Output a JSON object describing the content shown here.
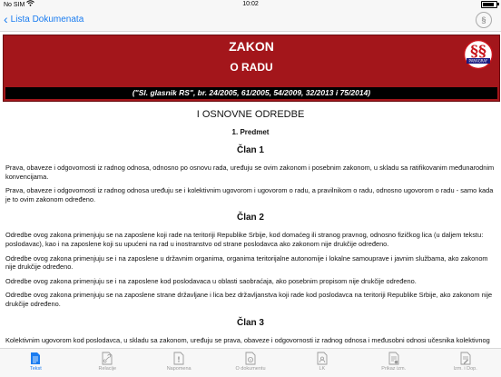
{
  "status": {
    "carrier": "No SIM",
    "time": "10:02",
    "battery_level": 0.85
  },
  "nav": {
    "back_label": "Lista Dokumenata"
  },
  "banner": {
    "title": "ZAKON",
    "subtitle": "O RADU",
    "gazette": "(\"Sl. glasnik RS\", br. 24/2005, 61/2005, 54/2009, 32/2013 i 75/2014)",
    "seal_text": "PARAGRAF"
  },
  "document": {
    "section_title": "I OSNOVNE ODREDBE",
    "subsection_title": "1. Predmet",
    "articles": [
      {
        "heading": "Član 1",
        "paragraphs": [
          "Prava, obaveze i odgovornosti iz radnog odnosa, odnosno po osnovu rada, uređuju se ovim zakonom i posebnim zakonom, u skladu sa ratifikovanim međunarodnim konvencijama.",
          "Prava, obaveze i odgovornosti iz radnog odnosa uređuju se i kolektivnim ugovorom i ugovorom o radu, a pravilnikom o radu, odnosno ugovorom o radu - samo kada je to ovim zakonom određeno."
        ]
      },
      {
        "heading": "Član 2",
        "paragraphs": [
          "Odredbe ovog zakona primenjuju se na zaposlene koji rade na teritoriji Republike Srbije, kod domaćeg ili stranog pravnog, odnosno fizičkog lica (u daljem tekstu: poslodavac), kao i na zaposlene koji su upućeni na rad u inostranstvo od strane poslodavca ako zakonom nije drukčije određeno.",
          "Odredbe ovog zakona primenjuju se i na zaposlene u državnim organima, organima teritorijalne autonomije i lokalne samouprave i javnim službama, ako zakonom nije drukčije određeno.",
          "Odredbe ovog zakona primenjuju se i na zaposlene kod poslodavaca u oblasti saobraćaja, ako posebnim propisom nije drukčije određeno.",
          "Odredbe ovog zakona primenjuju se na zaposlene strane državljane i lica bez državljanstva koji rade kod poslodavca na teritoriji Republike Srbije, ako zakonom nije drukčije određeno."
        ]
      },
      {
        "heading": "Član 3",
        "paragraphs": [
          "Kolektivnim ugovorom kod poslodavca, u skladu sa zakonom, uređuju se prava, obaveze i odgovornosti iz radnog odnosa i međusobni odnosi učesnika kolektivnog ugovora."
        ]
      }
    ]
  },
  "tabs": [
    {
      "label": "Tekst",
      "icon": "document-text-icon",
      "active": true
    },
    {
      "label": "Relacije",
      "icon": "link-icon",
      "active": false
    },
    {
      "label": "Napomena",
      "icon": "note-icon",
      "active": false
    },
    {
      "label": "O dokumentu",
      "icon": "document-info-icon",
      "active": false
    },
    {
      "label": "LK",
      "icon": "id-card-icon",
      "active": false
    },
    {
      "label": "Prikaz izm.",
      "icon": "document-changes-icon",
      "active": false
    },
    {
      "label": "Izm. i Dop.",
      "icon": "document-edit-icon",
      "active": false
    }
  ],
  "colors": {
    "accent": "#1a7cf0",
    "banner": "#a3161b",
    "seal": "#c8131a"
  }
}
